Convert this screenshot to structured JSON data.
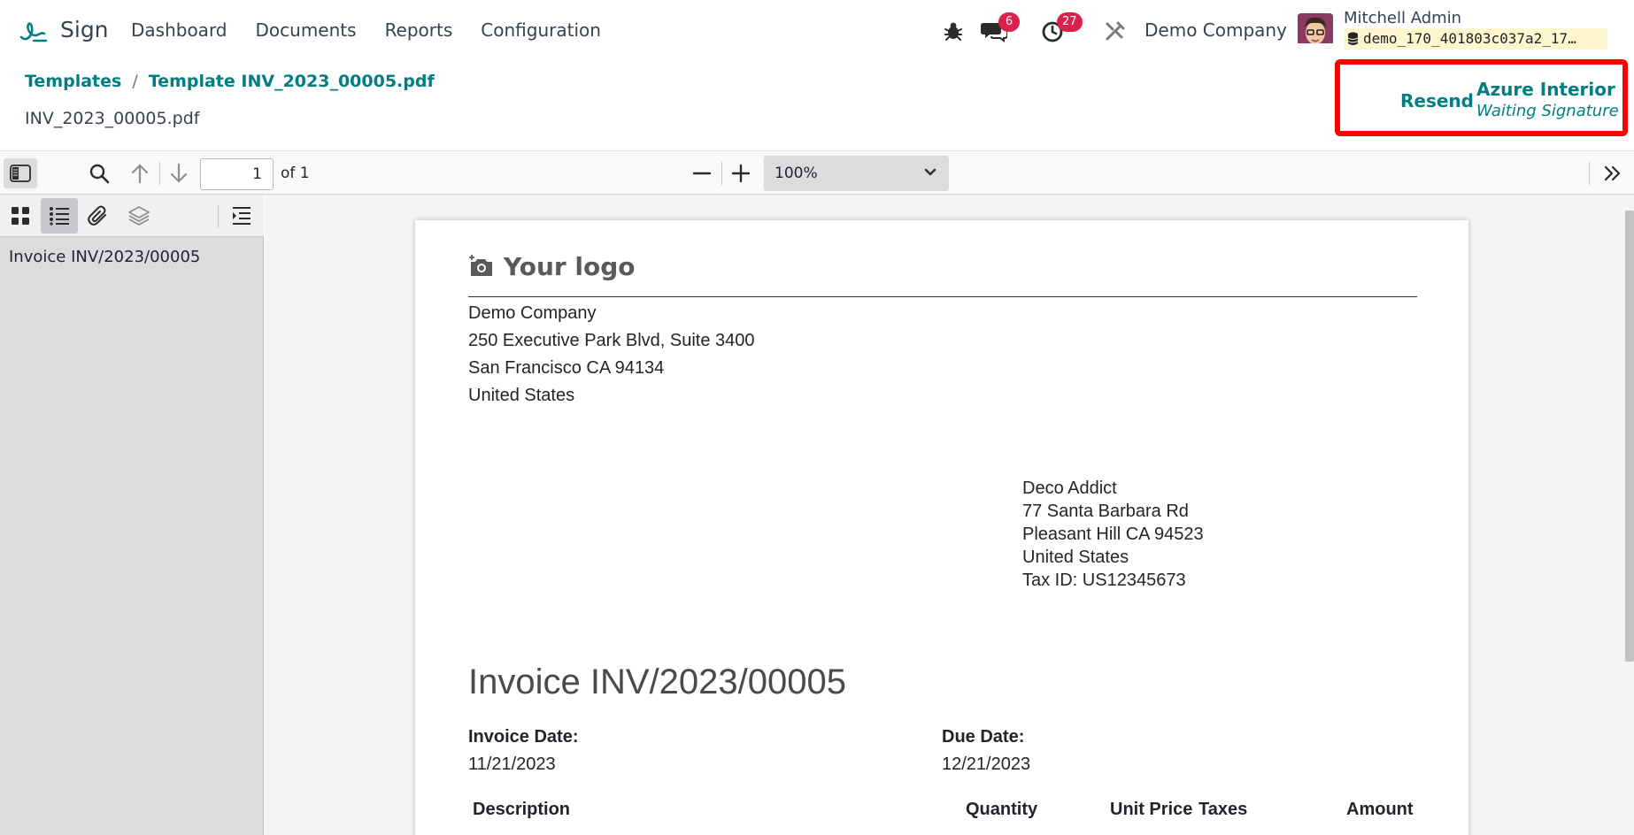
{
  "navbar": {
    "app_name": "Sign",
    "menu": [
      "Dashboard",
      "Documents",
      "Reports",
      "Configuration"
    ],
    "messages_count": "6",
    "activities_count": "27",
    "company": "Demo Company",
    "user_name": "Mitchell Admin",
    "database": "demo_170_401803c037a2_17…"
  },
  "control_panel": {
    "breadcrumb": [
      "Templates",
      "Template INV_2023_00005.pdf"
    ],
    "document_name": "INV_2023_00005.pdf",
    "resend_label": "Resend",
    "signer_name": "Azure Interior",
    "signer_status": "Waiting Signature"
  },
  "pdf_toolbar": {
    "page_number": "1",
    "page_total": "of 1",
    "zoom": "100%"
  },
  "sidebar": {
    "outline": [
      "Invoice INV/2023/00005"
    ]
  },
  "document": {
    "logo_text": "Your logo",
    "company_address": [
      "Demo Company",
      "250 Executive Park Blvd, Suite 3400",
      "San Francisco CA 94134",
      "United States"
    ],
    "customer_address": [
      "Deco Addict",
      "77 Santa Barbara Rd",
      "Pleasant Hill CA 94523",
      "United States",
      "Tax ID: US12345673"
    ],
    "title": "Invoice INV/2023/00005",
    "invoice_date_label": "Invoice Date:",
    "invoice_date": "11/21/2023",
    "due_date_label": "Due Date:",
    "due_date": "12/21/2023",
    "columns": [
      "Description",
      "Quantity",
      "Unit Price",
      "Taxes",
      "Amount"
    ]
  }
}
